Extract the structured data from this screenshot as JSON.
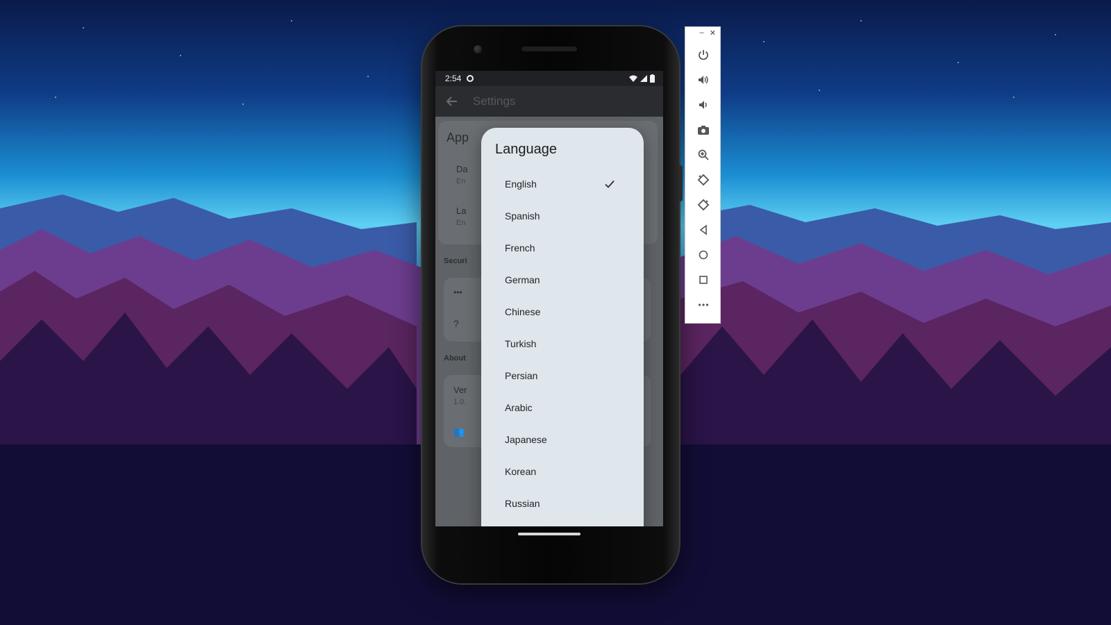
{
  "status_bar": {
    "time": "2:54"
  },
  "background_app": {
    "title": "Settings",
    "section_appearance": "App",
    "item_dark_mode": "Da",
    "item_dark_mode_sub": "En",
    "item_language": "La",
    "item_language_sub": "En",
    "section_security": "Securi",
    "section_about": "About",
    "item_version": "Ver",
    "item_version_sub": "1.0."
  },
  "dialog": {
    "title": "Language",
    "selected": "English",
    "options": [
      "English",
      "Spanish",
      "French",
      "German",
      "Chinese",
      "Turkish",
      "Persian",
      "Arabic",
      "Japanese",
      "Korean",
      "Russian"
    ]
  },
  "toolbar": {
    "buttons": [
      "power-icon",
      "volume-up-icon",
      "volume-down-icon",
      "camera-icon",
      "zoom-icon",
      "rotate-left-icon",
      "rotate-right-icon",
      "back-icon",
      "home-icon",
      "overview-icon",
      "more-icon"
    ]
  },
  "colors": {
    "dialog_bg": "#dfe6ec",
    "scrim_screen": "#606468",
    "toolbar_bg": "#ffffff"
  }
}
